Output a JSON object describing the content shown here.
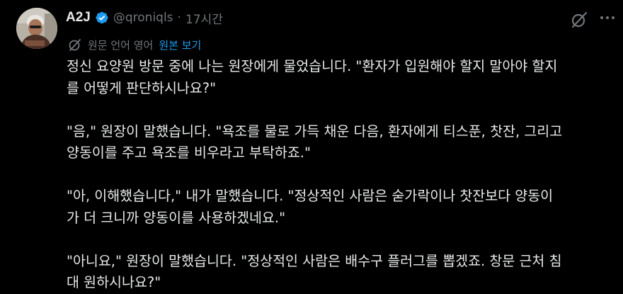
{
  "post": {
    "author": {
      "name": "A2J",
      "handle": "@qroniqls",
      "verified": true,
      "avatar_icon": "avatar-photo"
    },
    "separator": "·",
    "time": "17시간",
    "actions": {
      "grok_icon": "grok-slash-icon",
      "more_icon": "more-dots-icon"
    },
    "translation": {
      "icon": "translate-icon",
      "label": "원문 언어 영어",
      "show_original": "원본 보기"
    },
    "paragraphs": [
      [
        "정신 요양원 방문 중에 나는 원장에게 물었습니다. \"환자가 입원해야 할지 말아야 할지",
        "를 어떻게 판단하시나요?\""
      ],
      [
        "\"음,\" 원장이 말했습니다. \"욕조를 물로 가득 채운 다음, 환자에게 티스푼, 찻잔, 그리고",
        "양동이를 주고 욕조를 비우라고 부탁하죠.\""
      ],
      [
        "\"아, 이해했습니다,\" 내가 말했습니다. \"정상적인 사람은 숟가락이나 찻잔보다 양동이",
        "가 더 크니까 양동이를 사용하겠네요.\""
      ],
      [
        "\"아니요,\" 원장이 말했습니다. \"정상적인 사람은 배수구 플러그를 뽑겠죠. 창문 근처 침",
        "대 원하시나요?\""
      ]
    ]
  },
  "colors": {
    "background": "#000000",
    "text": "#e7e9ea",
    "secondary": "#71767b",
    "accent": "#1d9bf0"
  }
}
